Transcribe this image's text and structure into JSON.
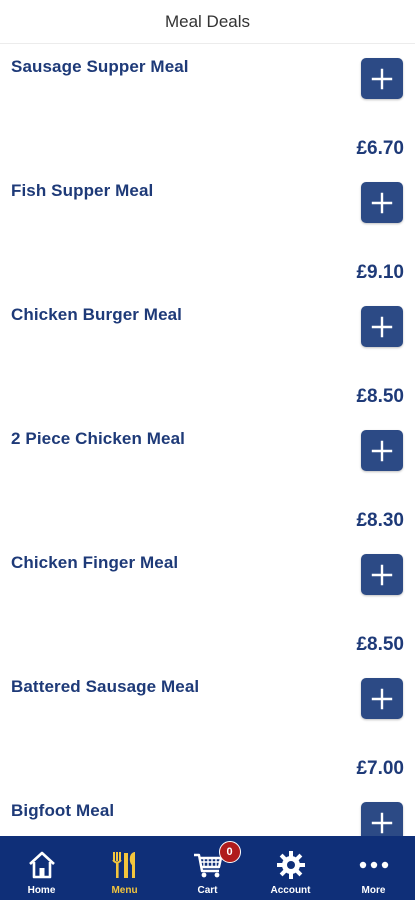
{
  "header": {
    "title": "Meal Deals"
  },
  "items": [
    {
      "name": "Sausage Supper Meal",
      "price": "£6.70"
    },
    {
      "name": "Fish Supper Meal",
      "price": "£9.10"
    },
    {
      "name": "Chicken Burger Meal",
      "price": "£8.50"
    },
    {
      "name": "2 Piece Chicken Meal",
      "price": "£8.30"
    },
    {
      "name": "Chicken Finger Meal",
      "price": "£8.50"
    },
    {
      "name": "Battered Sausage Meal",
      "price": "£7.00"
    },
    {
      "name": "Bigfoot Meal",
      "price": ""
    }
  ],
  "colors": {
    "primary": "#1e3a78",
    "button": "#2c4a85",
    "tabbar": "#0f2f78",
    "active_tab": "#f3c53d",
    "badge": "#b01c1c"
  },
  "tabs": [
    {
      "label": "Home",
      "icon": "home-icon"
    },
    {
      "label": "Menu",
      "icon": "fork-knife-icon"
    },
    {
      "label": "Cart",
      "icon": "cart-icon",
      "badge": "0"
    },
    {
      "label": "Account",
      "icon": "gear-icon"
    },
    {
      "label": "More",
      "icon": "more-dots-icon"
    }
  ]
}
